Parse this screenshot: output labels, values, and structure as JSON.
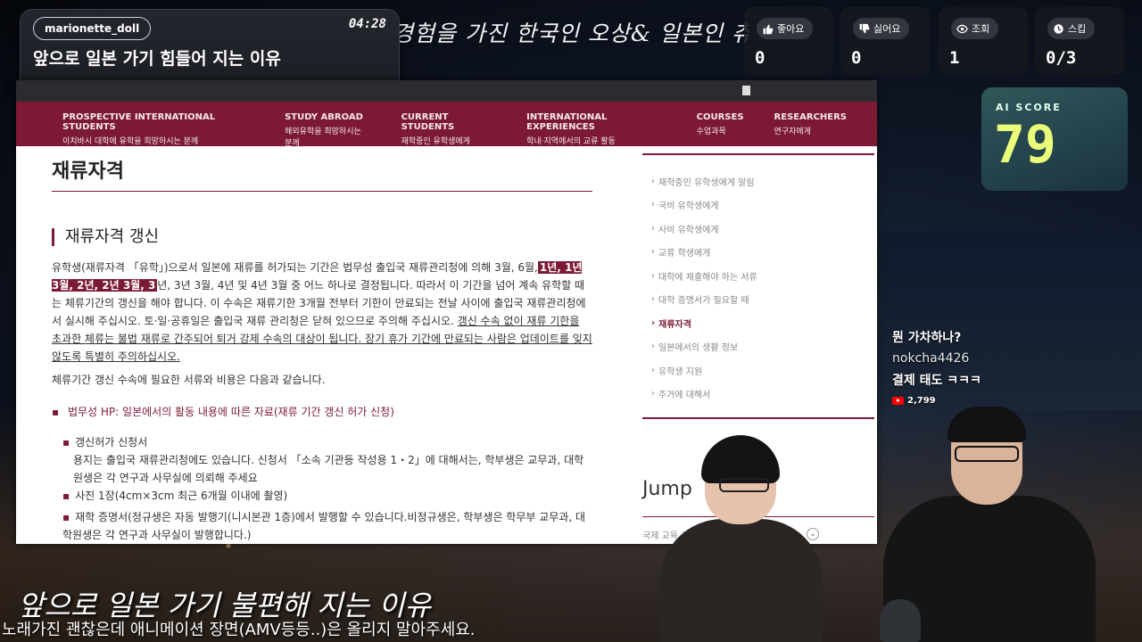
{
  "stream": {
    "channel": "marionette_doll",
    "time": "04:28",
    "card_title": "앞으로 일본 가기 힘들어 지는 이유",
    "progress": 0.33,
    "background_title": "경험을 가진 한국인 오상& 일본인 츄미코",
    "ai_label": "AI SCORE",
    "ai_score": "79"
  },
  "stats": [
    {
      "label": "좋아요",
      "value": "0",
      "icon": "thumbs-up-icon"
    },
    {
      "label": "싫어요",
      "value": "0",
      "icon": "thumbs-down-icon"
    },
    {
      "label": "조회",
      "value": "1",
      "icon": "eye-icon"
    },
    {
      "label": "스킵",
      "value": "0/3",
      "icon": "clock-icon"
    }
  ],
  "site": {
    "nav": [
      {
        "en": "PROSPECTIVE INTERNATIONAL STUDENTS",
        "ko": "이치바시 대학에 유학을 희망하시는 분께"
      },
      {
        "en": "STUDY ABROAD",
        "ko": "해외유학을 희망하시는 분께"
      },
      {
        "en": "CURRENT STUDENTS",
        "ko": "재학중인 유학생에게"
      },
      {
        "en": "INTERNATIONAL EXPERIENCES",
        "ko": "학내·지역에서의 교류 활동"
      },
      {
        "en": "COURSES",
        "ko": "수업과목"
      },
      {
        "en": "RESEARCHERS",
        "ko": "연구자에게"
      }
    ],
    "h1": "재류자격",
    "h2": "재류자격 갱신",
    "para1_a": "유학생(재류자격 「유학」)으로서 일본에 재류를 허가되는 기간은 법무성 출입국 재류관리청에 의해 3월, 6월,",
    "para1_hl": "1년, 1년 3월, 2년, 2년 3월, 3",
    "para1_b": "년, 3년 3월, 4년 및 4년 3월 중 어느 하나로 결정됩니다. 따라서 이 기간을 넘어 계속 유학할 때는 체류기간의 갱신을 해야 합니다. 이 수속은 재류기한 3개월 전부터 기한이 만료되는 전날 사이에 출입국 재류관리청에서 실시해 주십시오. 토·일·공휴일은 출입국 재류 관리청은 닫혀 있으므로 주의해 주십시오.",
    "para1_ul": "갱신 수속 없이 재류 기한을 초과한 체류는 불법 재류로 간주되어 퇴거 강제 수속의 대상이 됩니다. 장기 휴가 기간에 만료되는 사람은 업데이트를 잊지 않도록 특별히 주의하십시오.",
    "para2": "체류기간 갱신 수속에 필요한 서류와 비용은 다음과 같습니다.",
    "bullet_ministry_prefix": "법무성 HP:",
    "bullet_ministry_link": "일본에서의 활동 내용에 따른 자료(재류 기간 갱신 허가 신청)",
    "bullet_apply": "갱신허가 신청서",
    "apply_text": "용지는 출입국 재류관리청에도 있습니다. 신청서 「소속 기관등 작성용 1・2」에 대해서는, 학부생은 교무과, 대학원생은 각 연구과 사무실에 의뢰해 주세요",
    "bullet_photo": "사진 1장(4cm×3cm 최근 6개월 이내에 촬영)",
    "bullet_cert": "재학 증명서(정규생은 자동 발행기(니시본관 1층)에서 발행할 수 있습니다.비정규생은, 학부생은 학무부 교무과, 대학원생은 각 연구과 사무실이 발행합니다.)",
    "sidebar": [
      "재학중인 유학생에게 알림",
      "국비 유학생에게",
      "사비 유학생에게",
      "교류 학생에게",
      "대학에 제출해야 하는 서류",
      "대학 증명서가 필요할 때",
      "재류자격",
      "일본에서의 생활 정보",
      "유학생 지원",
      "주거에 대해서"
    ],
    "sidebar_active": "재류자격",
    "jump_title": "Jump",
    "jump_select": "국제 교육 교류"
  },
  "chat": {
    "question": "뭔 가차하나?",
    "user": "nokcha4426",
    "message": "결제 태도 ㅋㅋㅋ",
    "yt_count": "2,799"
  },
  "captions": {
    "big": "앞으로 일본 가기 불편해 지는 이유",
    "small": "노래가진 괜찮은데 애니메이션 장면(AMV등등..)은 올리지 말아주세요."
  },
  "colors": {
    "brand": "#7c1a35",
    "progress": "#e0742a",
    "ai_score": "#e9ff7a"
  }
}
